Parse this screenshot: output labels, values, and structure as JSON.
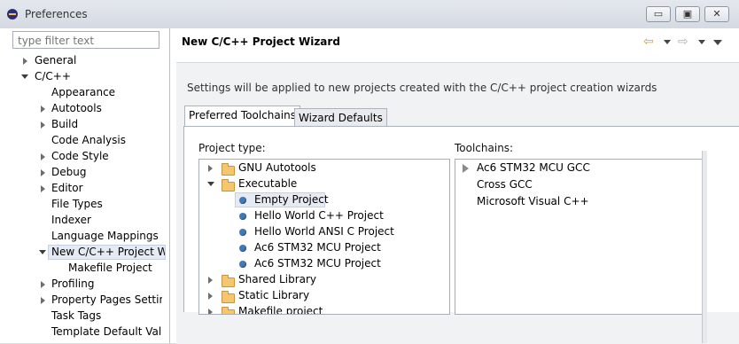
{
  "window": {
    "title": "Preferences",
    "controls": [
      "▭",
      "▣",
      "✕"
    ]
  },
  "sidebar": {
    "filter_placeholder": "type filter text",
    "items": [
      {
        "label": "General"
      },
      {
        "label": "C/C++"
      },
      {
        "label": "Appearance"
      },
      {
        "label": "Autotools"
      },
      {
        "label": "Build"
      },
      {
        "label": "Code Analysis"
      },
      {
        "label": "Code Style"
      },
      {
        "label": "Debug"
      },
      {
        "label": "Editor"
      },
      {
        "label": "File Types"
      },
      {
        "label": "Indexer"
      },
      {
        "label": "Language Mappings"
      },
      {
        "label": "New C/C++ Project Wi"
      },
      {
        "label": "Makefile Project"
      },
      {
        "label": "Profiling"
      },
      {
        "label": "Property Pages Setting"
      },
      {
        "label": "Task Tags"
      },
      {
        "label": "Template Default Value"
      }
    ]
  },
  "page": {
    "title": "New C/C++ Project Wizard",
    "nav": {
      "back_icon": "⇦",
      "forward_icon": "⇨",
      "menu_icon": "▾"
    },
    "description": "Settings will be applied to new projects created with the C/C++ project creation wizards",
    "tabs": [
      "Preferred Toolchains",
      "Wizard Defaults"
    ],
    "project_type_label": "Project type:",
    "toolchains_label": "Toolchains:",
    "project_types": [
      {
        "label": "GNU Autotools"
      },
      {
        "label": "Executable"
      },
      {
        "label": "Empty Project"
      },
      {
        "label": "Hello World C++ Project"
      },
      {
        "label": "Hello World ANSI C Project"
      },
      {
        "label": "Ac6 STM32 MCU Project"
      },
      {
        "label": "Ac6 STM32 MCU Project"
      },
      {
        "label": "Shared Library"
      },
      {
        "label": "Static Library"
      },
      {
        "label": "Makefile project"
      }
    ],
    "toolchains": [
      {
        "label": "Ac6 STM32 MCU GCC"
      },
      {
        "label": "Cross GCC"
      },
      {
        "label": "Microsoft Visual C++"
      }
    ]
  }
}
